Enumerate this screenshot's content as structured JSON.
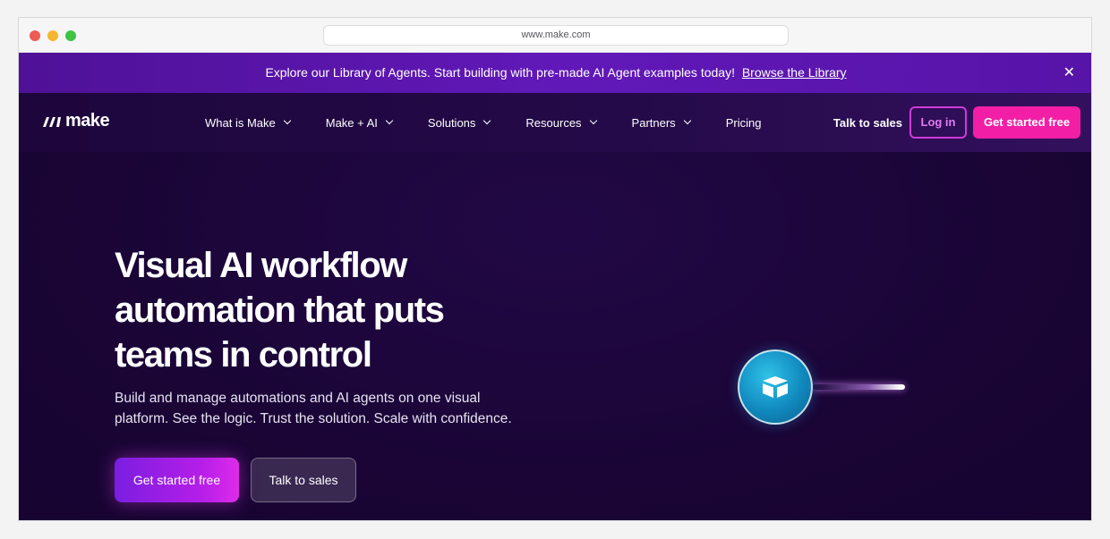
{
  "browser": {
    "url": "www.make.com"
  },
  "banner": {
    "text": "Explore our Library of Agents. Start building with pre-made AI Agent examples today!",
    "link": "Browse the Library",
    "close": "✕"
  },
  "nav": {
    "logo_text": "make",
    "items": [
      {
        "label": "What is Make"
      },
      {
        "label": "Make + AI"
      },
      {
        "label": "Solutions"
      },
      {
        "label": "Resources"
      },
      {
        "label": "Partners"
      },
      {
        "label": "Pricing"
      }
    ],
    "talk_to_sales": "Talk to sales",
    "login": "Log in",
    "get_started": "Get started free"
  },
  "hero": {
    "headline": "Visual AI workflow automation that puts teams in control",
    "subtext": "Build and manage automations and AI agents on one visual platform. See the logic. Trust the solution. Scale with confidence.",
    "cta_primary": "Get started free",
    "cta_secondary": "Talk to sales"
  },
  "colors": {
    "brand_pink": "#f21ea6",
    "banner_purple": "#5a14ad",
    "hero_bg": "#1a0536",
    "orb_blue": "#1a9fd0"
  }
}
